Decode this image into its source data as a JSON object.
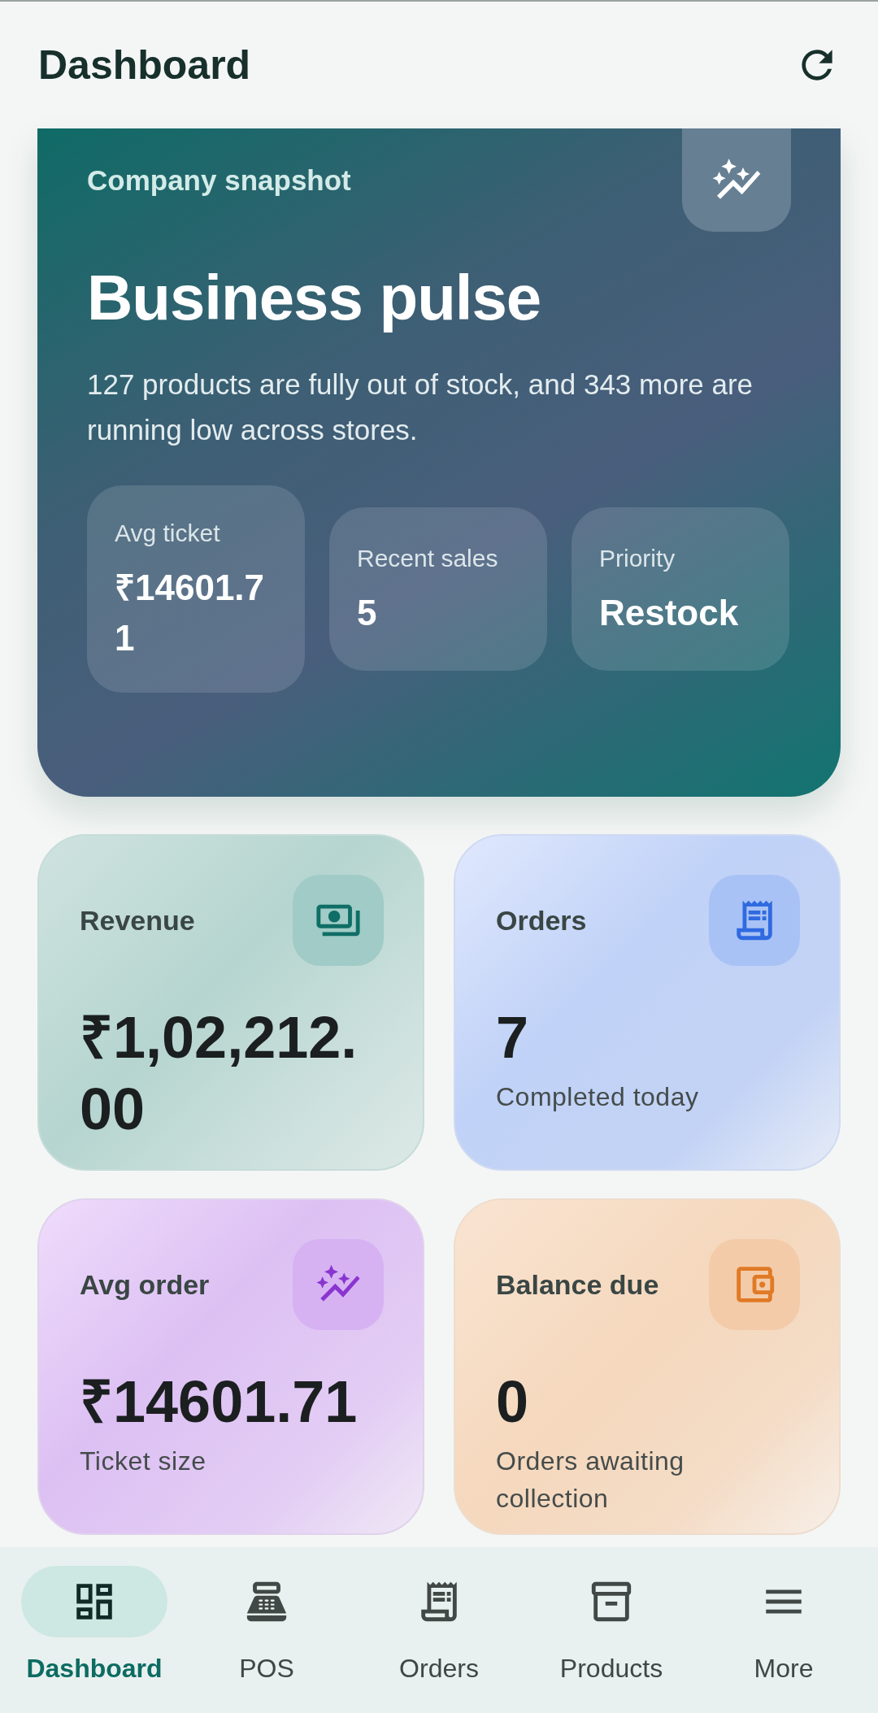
{
  "header": {
    "title": "Dashboard"
  },
  "hero": {
    "eyebrow": "Company snapshot",
    "title": "Business pulse",
    "description": "127 products are fully out of stock, and 343 more are running low across stores.",
    "stats": [
      {
        "label": "Avg ticket",
        "value": "₹14601.71"
      },
      {
        "label": "Recent sales",
        "value": "5"
      },
      {
        "label": "Priority",
        "value": "Restock"
      }
    ]
  },
  "cards": [
    {
      "label": "Revenue",
      "value": "₹1,02,212.00"
    },
    {
      "label": "Orders",
      "value": "7",
      "caption": "Completed today"
    },
    {
      "label": "Avg order",
      "value": "₹14601.71",
      "caption": "Ticket size"
    },
    {
      "label": "Balance due",
      "value": "0",
      "caption": "Orders awaiting collection"
    }
  ],
  "nav": [
    {
      "label": "Dashboard",
      "selected": true
    },
    {
      "label": "POS",
      "selected": false
    },
    {
      "label": "Orders",
      "selected": false
    },
    {
      "label": "Products",
      "selected": false
    },
    {
      "label": "More",
      "selected": false
    }
  ]
}
